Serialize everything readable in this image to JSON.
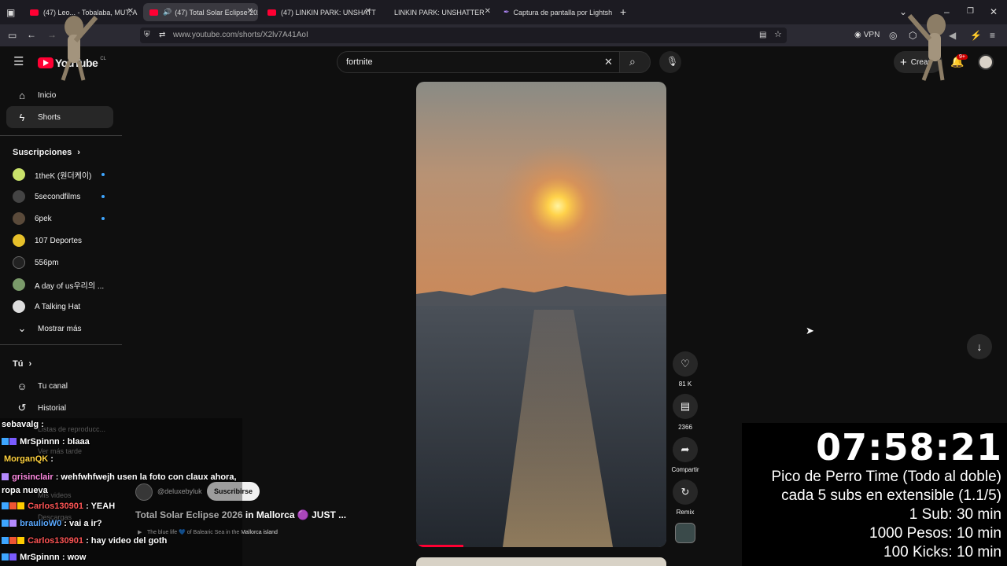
{
  "browser": {
    "tabs": [
      {
        "label": "(47) Leo... - Tobalaba, MUT, A",
        "active": false
      },
      {
        "label": "(47) Total Solar Eclipse 2026",
        "active": true
      },
      {
        "label": "(47) LINKIN PARK: UNSHATTER",
        "active": false
      },
      {
        "label": "LINKIN PARK: UNSHATTER",
        "active": false
      },
      {
        "label": "Captura de pantalla por Lightsh",
        "active": false
      }
    ],
    "url": "www.youtube.com/shorts/X2lv7A41AoI",
    "vpn_label": "VPN",
    "notif_count": "9+"
  },
  "youtube": {
    "logo_text": "YouTube",
    "logo_region": "CL",
    "search_value": "fortnite",
    "create_label": "Crear",
    "nav": {
      "home": "Inicio",
      "shorts": "Shorts"
    },
    "subs_header": "Suscripciones",
    "subs": [
      {
        "name": "1theK (원더케이)",
        "dot": true,
        "color": "#c9e26a"
      },
      {
        "name": "5secondfilms",
        "dot": true,
        "color": "#444"
      },
      {
        "name": "6pek",
        "dot": true,
        "color": "#5a4a3a"
      },
      {
        "name": "107 Deportes",
        "dot": false,
        "color": "#e6c02a"
      },
      {
        "name": "556pm",
        "dot": false,
        "color": "#222"
      },
      {
        "name": "A day of us우리의 ...",
        "dot": false,
        "color": "#7a9a6a"
      },
      {
        "name": "A Talking Hat",
        "dot": false,
        "color": "#ddd"
      }
    ],
    "show_more": "Mostrar más",
    "you_header": "Tú",
    "you_items": [
      "Tu canal",
      "Historial"
    ],
    "hidden_items": [
      "Listas de reproducc...",
      "Ver más tarde",
      "Mis videos",
      "Descargas"
    ]
  },
  "short": {
    "likes": "81 K",
    "comments": "2366",
    "share_label": "Compartir",
    "remix_label": "Remix",
    "channel": "@deluxebyluk",
    "subscribe_label": "Suscribirse",
    "title": "Total Solar Eclipse 2026 in Mallorca 🟣 JUST ...",
    "audio": "The blue life 💙 of Balearic Sea in the Mallorca island"
  },
  "chat": [
    {
      "user": "sebavalg",
      "msg": "",
      "color": "#ffffff"
    },
    {
      "user": "MrSpinnn",
      "msg": "blaaa",
      "color": "#ffffff"
    },
    {
      "user": "MorganQK",
      "msg": "",
      "color": "#ffd23f"
    },
    {
      "user": "grisinclair",
      "msg": "wehfwhfwejh usen la foto con claux ahora, ropa nueva",
      "color": "#ff8ae2"
    },
    {
      "user": "Carlos130901",
      "msg": "YEAH",
      "color": "#ff5555"
    },
    {
      "user": "braulioW0",
      "msg": "vai a ir?",
      "color": "#5aa9ff"
    },
    {
      "user": "Carlos130901",
      "msg": "hay video del goth",
      "color": "#ff5555"
    },
    {
      "user": "MrSpinnn",
      "msg": "wow",
      "color": "#ffffff"
    }
  ],
  "overlay": {
    "clock": "07:58:21",
    "lines": [
      "Pico de Perro Time (Todo al doble)",
      "cada 5 subs en extensible (1.1/5)",
      "1 Sub: 30 min",
      "1000 Pesos: 10 min",
      "100 Kicks: 10 min"
    ]
  }
}
